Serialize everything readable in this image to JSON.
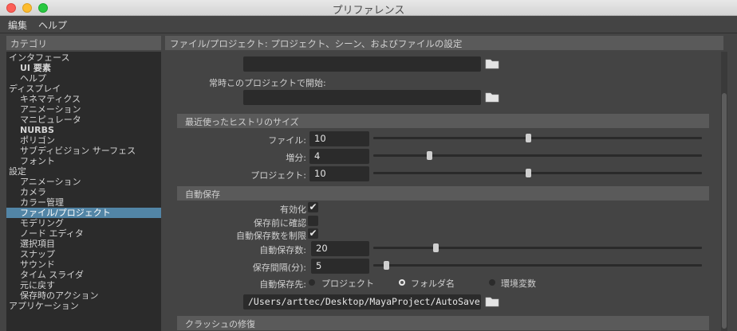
{
  "window": {
    "title": "プリファレンス"
  },
  "menu": {
    "edit": "編集",
    "help": "ヘルプ"
  },
  "categories": {
    "header": "カテゴリ",
    "items": [
      {
        "label": "インタフェース",
        "level": 0
      },
      {
        "label": "UI 要素",
        "level": 1,
        "bold": true
      },
      {
        "label": "ヘルプ",
        "level": 1
      },
      {
        "label": "ディスプレイ",
        "level": 0
      },
      {
        "label": "キネマティクス",
        "level": 1
      },
      {
        "label": "アニメーション",
        "level": 1
      },
      {
        "label": "マニピュレータ",
        "level": 1
      },
      {
        "label": "NURBS",
        "level": 1,
        "bold": true
      },
      {
        "label": "ポリゴン",
        "level": 1
      },
      {
        "label": "サブディビジョン サーフェス",
        "level": 1
      },
      {
        "label": "フォント",
        "level": 1
      },
      {
        "label": "設定",
        "level": 0
      },
      {
        "label": "アニメーション",
        "level": 1
      },
      {
        "label": "カメラ",
        "level": 1
      },
      {
        "label": "カラー管理",
        "level": 1
      },
      {
        "label": "ファイル/プロジェクト",
        "level": 1,
        "selected": true
      },
      {
        "label": "モデリング",
        "level": 1
      },
      {
        "label": "ノード エディタ",
        "level": 1
      },
      {
        "label": "選択項目",
        "level": 1
      },
      {
        "label": "スナップ",
        "level": 1
      },
      {
        "label": "サウンド",
        "level": 1
      },
      {
        "label": "タイム スライダ",
        "level": 1
      },
      {
        "label": "元に戻す",
        "level": 1
      },
      {
        "label": "保存時のアクション",
        "level": 1
      },
      {
        "label": "アプリケーション",
        "level": 0
      }
    ]
  },
  "main": {
    "header": "ファイル/プロジェクト: プロジェクト、シーン、およびファイルの設定",
    "top_path_value": "",
    "always_start_label": "常時このプロジェクトで開始:",
    "always_start_value": "",
    "recent": {
      "title": "最近使ったヒストリのサイズ",
      "rows": [
        {
          "label": "ファイル:",
          "value": "10",
          "fraction": 0.47
        },
        {
          "label": "増分:",
          "value": "4",
          "fraction": 0.17
        },
        {
          "label": "プロジェクト:",
          "value": "10",
          "fraction": 0.47
        }
      ]
    },
    "autosave": {
      "title": "自動保存",
      "enable_label": "有効化",
      "enable_checked": true,
      "prompt_label": "保存前に確認",
      "prompt_checked": false,
      "limit_label": "自動保存数を制限",
      "limit_checked": true,
      "count_label": "自動保存数:",
      "count_value": "20",
      "count_fraction": 0.19,
      "interval_label": "保存間隔(分):",
      "interval_value": "5",
      "interval_fraction": 0.04,
      "dest_label": "自動保存先:",
      "dest_options": [
        "プロジェクト",
        "フォルダ名",
        "環境変数"
      ],
      "dest_selected": 1,
      "path": "/Users/arttec/Desktop/MayaProject/AutoSave"
    },
    "crash": {
      "title": "クラッシュの修復"
    }
  },
  "colors": {
    "selection": "#5285a6",
    "panel": "#444444",
    "field": "#2b2b2b",
    "section": "#5a5a5a"
  },
  "icons": {
    "folder": "folder-icon",
    "check": "check-icon"
  }
}
